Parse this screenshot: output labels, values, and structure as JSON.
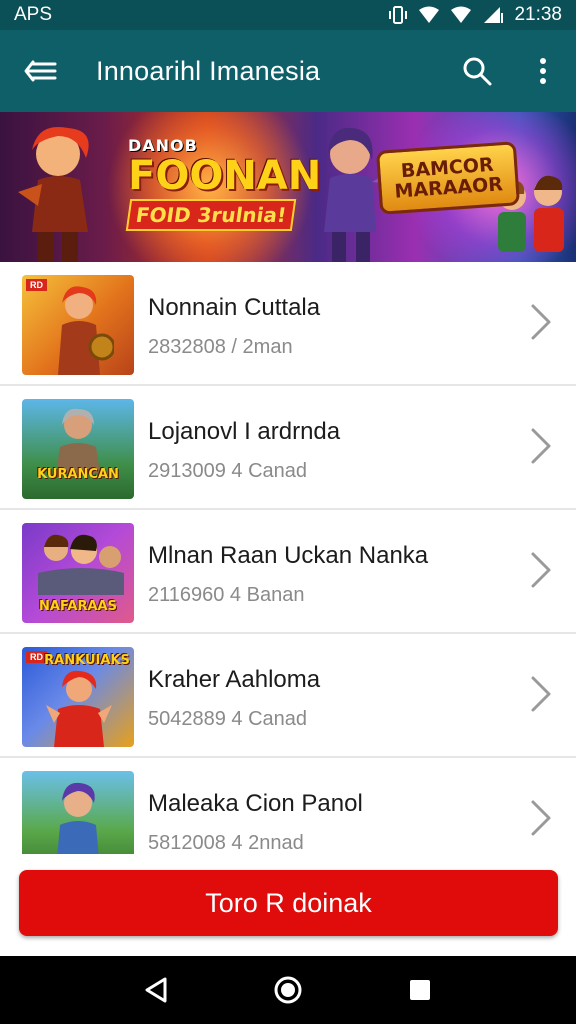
{
  "status_bar": {
    "carrier": "APS",
    "time": "21:38",
    "icons": [
      "vibrate-icon",
      "wifi-icon",
      "signal-icon",
      "battery-icon"
    ]
  },
  "app_bar": {
    "title": "Innoarihl Imanesia",
    "icons": [
      "back-arrow-icon",
      "search-icon",
      "more-vert-icon"
    ]
  },
  "banner": {
    "small_text": "DANOB",
    "big_text": "FOONAN",
    "ribbon_text": "FOID 3rulnia!",
    "badge_line1": "BAMCOR",
    "badge_line2": "MARAAOR"
  },
  "list": {
    "items": [
      {
        "title": "Nonnain Cuttala",
        "subtitle": "2832808 / 2man",
        "thumb_badge": "RD",
        "thumb_label": ""
      },
      {
        "title": "Lojanovl I ardrnda",
        "subtitle": "2913009 4 Canad",
        "thumb_badge": "",
        "thumb_label": "KURANCAN"
      },
      {
        "title": "Mlnan Raan Uckan Nanka",
        "subtitle": "2116960 4 Banan",
        "thumb_badge": "",
        "thumb_label": "NAFARAAS"
      },
      {
        "title": "Kraher Aahloma",
        "subtitle": "5042889 4 Canad",
        "thumb_badge": "RD",
        "thumb_label": "RANKUIAKS"
      },
      {
        "title": "Maleaka Cion Panol",
        "subtitle": "5812008 4 2nnad",
        "thumb_badge": "",
        "thumb_label": ""
      }
    ]
  },
  "cta": {
    "label": "Toro R doinak"
  },
  "colors": {
    "status_bar": "#0b4f57",
    "app_bar": "#0e5f68",
    "cta": "#e00b0b",
    "nav_bar": "#000000"
  }
}
